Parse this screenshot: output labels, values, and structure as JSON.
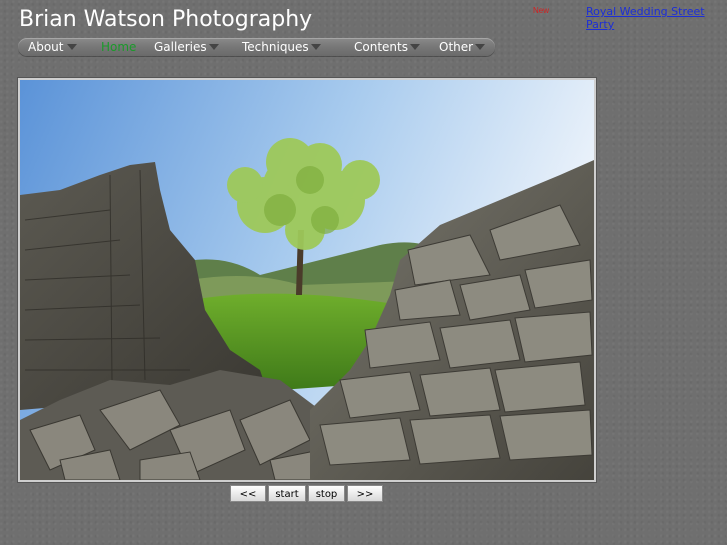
{
  "header": {
    "site_title": "Brian Watson Photography",
    "new_tag": "New",
    "new_link": "Royal Wedding Street Party"
  },
  "nav": {
    "items": [
      {
        "label": "About",
        "has_dropdown": true
      },
      {
        "label": "Home",
        "has_dropdown": false,
        "active": true
      },
      {
        "label": "Galleries",
        "has_dropdown": true
      },
      {
        "label": "Techniques",
        "has_dropdown": true
      },
      {
        "label": "Contents",
        "has_dropdown": true
      },
      {
        "label": "Other",
        "has_dropdown": true
      }
    ],
    "active_color": "#1a9a2a"
  },
  "slideshow": {
    "controls": {
      "prev": "<<",
      "start": "start",
      "stop": "stop",
      "next": ">>"
    }
  },
  "colors": {
    "background": "#6f6f6f",
    "link": "#1d2fd6",
    "new_tag": "#d42020"
  }
}
